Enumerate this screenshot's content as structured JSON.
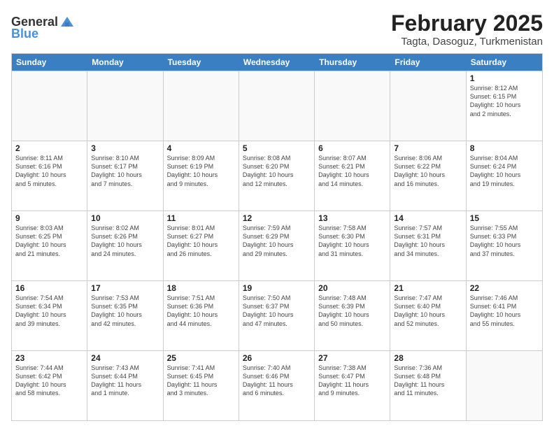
{
  "header": {
    "logo_general": "General",
    "logo_blue": "Blue",
    "title": "February 2025",
    "subtitle": "Tagta, Dasoguz, Turkmenistan"
  },
  "calendar": {
    "weekdays": [
      "Sunday",
      "Monday",
      "Tuesday",
      "Wednesday",
      "Thursday",
      "Friday",
      "Saturday"
    ],
    "rows": [
      [
        {
          "day": "",
          "info": ""
        },
        {
          "day": "",
          "info": ""
        },
        {
          "day": "",
          "info": ""
        },
        {
          "day": "",
          "info": ""
        },
        {
          "day": "",
          "info": ""
        },
        {
          "day": "",
          "info": ""
        },
        {
          "day": "1",
          "info": "Sunrise: 8:12 AM\nSunset: 6:15 PM\nDaylight: 10 hours\nand 2 minutes."
        }
      ],
      [
        {
          "day": "2",
          "info": "Sunrise: 8:11 AM\nSunset: 6:16 PM\nDaylight: 10 hours\nand 5 minutes."
        },
        {
          "day": "3",
          "info": "Sunrise: 8:10 AM\nSunset: 6:17 PM\nDaylight: 10 hours\nand 7 minutes."
        },
        {
          "day": "4",
          "info": "Sunrise: 8:09 AM\nSunset: 6:19 PM\nDaylight: 10 hours\nand 9 minutes."
        },
        {
          "day": "5",
          "info": "Sunrise: 8:08 AM\nSunset: 6:20 PM\nDaylight: 10 hours\nand 12 minutes."
        },
        {
          "day": "6",
          "info": "Sunrise: 8:07 AM\nSunset: 6:21 PM\nDaylight: 10 hours\nand 14 minutes."
        },
        {
          "day": "7",
          "info": "Sunrise: 8:06 AM\nSunset: 6:22 PM\nDaylight: 10 hours\nand 16 minutes."
        },
        {
          "day": "8",
          "info": "Sunrise: 8:04 AM\nSunset: 6:24 PM\nDaylight: 10 hours\nand 19 minutes."
        }
      ],
      [
        {
          "day": "9",
          "info": "Sunrise: 8:03 AM\nSunset: 6:25 PM\nDaylight: 10 hours\nand 21 minutes."
        },
        {
          "day": "10",
          "info": "Sunrise: 8:02 AM\nSunset: 6:26 PM\nDaylight: 10 hours\nand 24 minutes."
        },
        {
          "day": "11",
          "info": "Sunrise: 8:01 AM\nSunset: 6:27 PM\nDaylight: 10 hours\nand 26 minutes."
        },
        {
          "day": "12",
          "info": "Sunrise: 7:59 AM\nSunset: 6:29 PM\nDaylight: 10 hours\nand 29 minutes."
        },
        {
          "day": "13",
          "info": "Sunrise: 7:58 AM\nSunset: 6:30 PM\nDaylight: 10 hours\nand 31 minutes."
        },
        {
          "day": "14",
          "info": "Sunrise: 7:57 AM\nSunset: 6:31 PM\nDaylight: 10 hours\nand 34 minutes."
        },
        {
          "day": "15",
          "info": "Sunrise: 7:55 AM\nSunset: 6:33 PM\nDaylight: 10 hours\nand 37 minutes."
        }
      ],
      [
        {
          "day": "16",
          "info": "Sunrise: 7:54 AM\nSunset: 6:34 PM\nDaylight: 10 hours\nand 39 minutes."
        },
        {
          "day": "17",
          "info": "Sunrise: 7:53 AM\nSunset: 6:35 PM\nDaylight: 10 hours\nand 42 minutes."
        },
        {
          "day": "18",
          "info": "Sunrise: 7:51 AM\nSunset: 6:36 PM\nDaylight: 10 hours\nand 44 minutes."
        },
        {
          "day": "19",
          "info": "Sunrise: 7:50 AM\nSunset: 6:37 PM\nDaylight: 10 hours\nand 47 minutes."
        },
        {
          "day": "20",
          "info": "Sunrise: 7:48 AM\nSunset: 6:39 PM\nDaylight: 10 hours\nand 50 minutes."
        },
        {
          "day": "21",
          "info": "Sunrise: 7:47 AM\nSunset: 6:40 PM\nDaylight: 10 hours\nand 52 minutes."
        },
        {
          "day": "22",
          "info": "Sunrise: 7:46 AM\nSunset: 6:41 PM\nDaylight: 10 hours\nand 55 minutes."
        }
      ],
      [
        {
          "day": "23",
          "info": "Sunrise: 7:44 AM\nSunset: 6:42 PM\nDaylight: 10 hours\nand 58 minutes."
        },
        {
          "day": "24",
          "info": "Sunrise: 7:43 AM\nSunset: 6:44 PM\nDaylight: 11 hours\nand 1 minute."
        },
        {
          "day": "25",
          "info": "Sunrise: 7:41 AM\nSunset: 6:45 PM\nDaylight: 11 hours\nand 3 minutes."
        },
        {
          "day": "26",
          "info": "Sunrise: 7:40 AM\nSunset: 6:46 PM\nDaylight: 11 hours\nand 6 minutes."
        },
        {
          "day": "27",
          "info": "Sunrise: 7:38 AM\nSunset: 6:47 PM\nDaylight: 11 hours\nand 9 minutes."
        },
        {
          "day": "28",
          "info": "Sunrise: 7:36 AM\nSunset: 6:48 PM\nDaylight: 11 hours\nand 11 minutes."
        },
        {
          "day": "",
          "info": ""
        }
      ]
    ]
  }
}
